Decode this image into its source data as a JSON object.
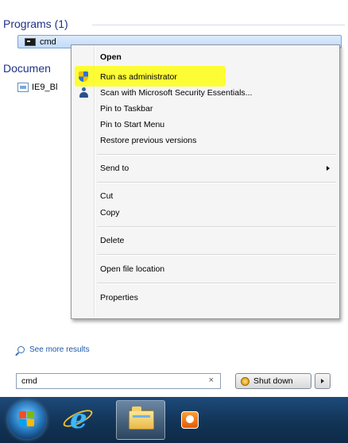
{
  "results": {
    "programs_header": "Programs (1)",
    "program_item": "cmd",
    "documents_header": "Documen",
    "document_item": "IE9_Bl"
  },
  "context_menu": {
    "items": [
      {
        "label": "Open",
        "bold": true
      },
      {
        "label": "Run as administrator",
        "icon": "uac-shield-icon",
        "highlighted": true
      },
      {
        "label": "Scan with Microsoft Security Essentials...",
        "icon": "security-essentials-icon"
      },
      {
        "label": "Pin to Taskbar"
      },
      {
        "label": "Pin to Start Menu"
      },
      {
        "label": "Restore previous versions"
      },
      {
        "label": "Send to",
        "submenu": true
      },
      {
        "label": "Cut"
      },
      {
        "label": "Copy"
      },
      {
        "label": "Delete"
      },
      {
        "label": "Open file location"
      },
      {
        "label": "Properties"
      }
    ],
    "highlight_color": "#ffff00"
  },
  "bottom": {
    "see_more": "See more results",
    "search_value": "cmd",
    "search_clear": "×",
    "shutdown_label": "Shut down"
  },
  "taskbar": {
    "icons": [
      "windows-start-icon",
      "internet-explorer-icon",
      "windows-explorer-icon",
      "media-player-icon"
    ]
  },
  "colors": {
    "header_text": "#1e3287",
    "selection": "#c1dbfc",
    "taskbar": "#123456"
  }
}
